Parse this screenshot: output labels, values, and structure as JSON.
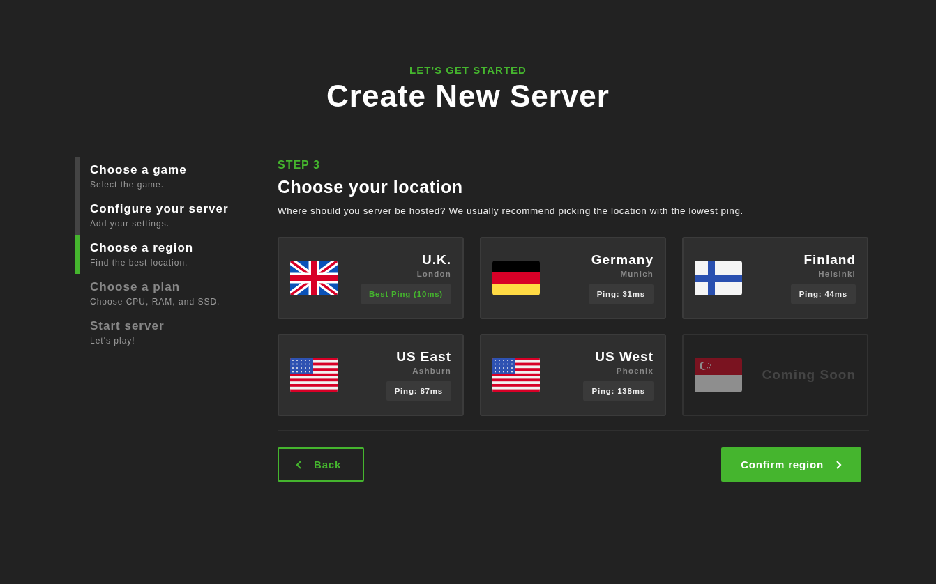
{
  "header": {
    "eyebrow": "LET'S GET STARTED",
    "title": "Create New Server"
  },
  "steps": [
    {
      "title": "Choose a game",
      "subtitle": "Select the game.",
      "completed": true,
      "selected": false
    },
    {
      "title": "Configure your server",
      "subtitle": "Add your settings.",
      "completed": true,
      "selected": false
    },
    {
      "title": "Choose a region",
      "subtitle": "Find the best location.",
      "completed": false,
      "selected": true
    },
    {
      "title": "Choose a plan",
      "subtitle": "Choose CPU, RAM, and SSD.",
      "completed": false,
      "selected": false
    },
    {
      "title": "Start server",
      "subtitle": "Let's play!",
      "completed": false,
      "selected": false
    }
  ],
  "section": {
    "step": "STEP 3",
    "title": "Choose your location",
    "description": "Where should you server be hosted? We usually recommend picking the location with the lowest ping."
  },
  "regions": [
    {
      "kind": "uk",
      "available": true,
      "name": "U.K.",
      "city": "London",
      "ping": "Best Ping (10ms)",
      "best": true
    },
    {
      "kind": "de",
      "available": true,
      "name": "Germany",
      "city": "Munich",
      "ping": "Ping: 31ms",
      "best": false
    },
    {
      "kind": "fi",
      "available": true,
      "name": "Finland",
      "city": "Helsinki",
      "ping": "Ping: 44ms",
      "best": false
    },
    {
      "kind": "us",
      "available": true,
      "name": "US East",
      "city": "Ashburn",
      "ping": "Ping: 87ms",
      "best": false
    },
    {
      "kind": "us",
      "available": true,
      "name": "US West",
      "city": "Phoenix",
      "ping": "Ping: 138ms",
      "best": false
    },
    {
      "kind": "sg",
      "available": false,
      "name": "Coming Soon"
    }
  ],
  "buttons": {
    "back": "Back",
    "confirm": "Confirm region"
  }
}
